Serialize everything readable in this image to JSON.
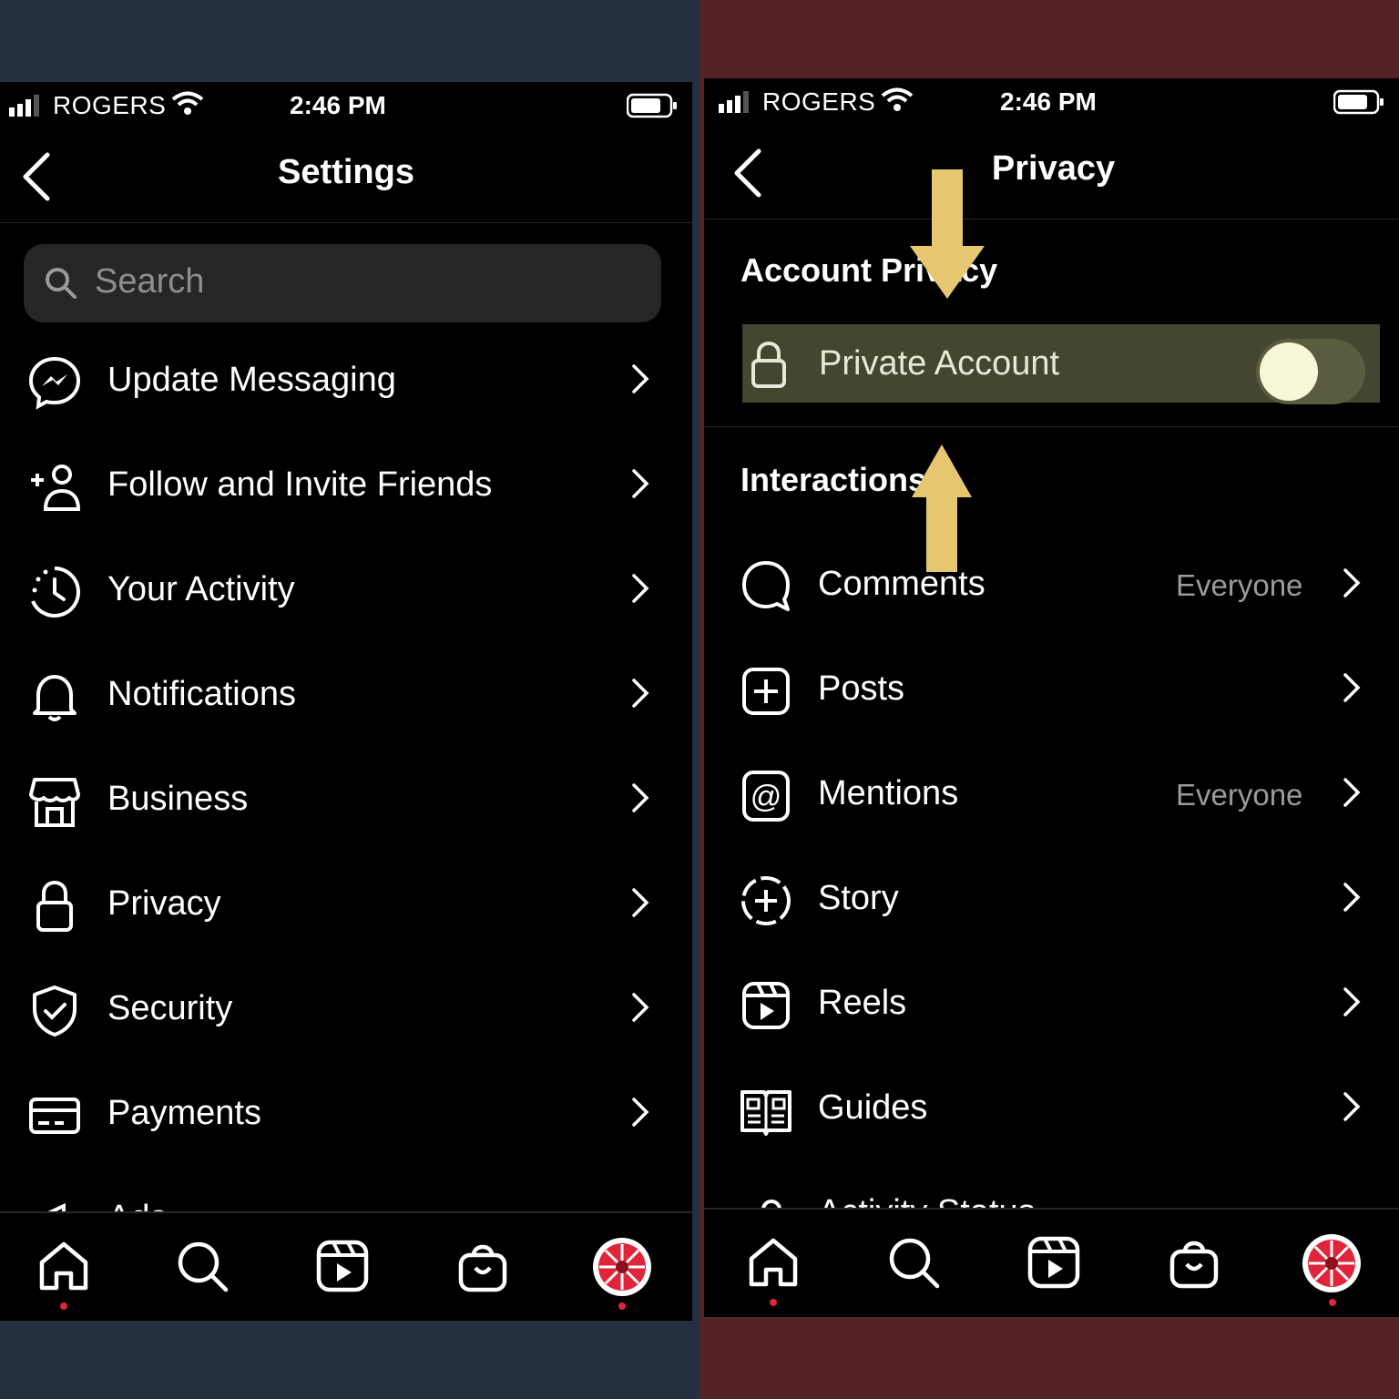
{
  "colors": {
    "left_background": "#243040",
    "right_background": "#552327",
    "highlight": "#44462f",
    "arrow": "#e6c66f",
    "notification_dot": "#e0243a"
  },
  "left": {
    "status": {
      "carrier": "ROGERS",
      "time": "2:46 PM"
    },
    "header": {
      "title": "Settings"
    },
    "search": {
      "placeholder": "Search"
    },
    "items": [
      {
        "label": "Update Messaging",
        "icon": "messenger-icon"
      },
      {
        "label": "Follow and Invite Friends",
        "icon": "add-person-icon"
      },
      {
        "label": "Your Activity",
        "icon": "activity-clock-icon"
      },
      {
        "label": "Notifications",
        "icon": "bell-icon"
      },
      {
        "label": "Business",
        "icon": "storefront-icon"
      },
      {
        "label": "Privacy",
        "icon": "lock-icon"
      },
      {
        "label": "Security",
        "icon": "shield-check-icon"
      },
      {
        "label": "Payments",
        "icon": "credit-card-icon"
      },
      {
        "label": "Ads",
        "icon": "megaphone-icon"
      }
    ]
  },
  "right": {
    "status": {
      "carrier": "ROGERS",
      "time": "2:46 PM"
    },
    "header": {
      "title": "Privacy"
    },
    "account_privacy": {
      "section_title": "Account Privacy",
      "private_account_label": "Private Account",
      "private_account_enabled": false
    },
    "interactions": {
      "section_title": "Interactions",
      "items": [
        {
          "label": "Comments",
          "value": "Everyone",
          "icon": "comment-bubble-icon"
        },
        {
          "label": "Posts",
          "value": "",
          "icon": "plus-square-icon"
        },
        {
          "label": "Mentions",
          "value": "Everyone",
          "icon": "at-sign-icon"
        },
        {
          "label": "Story",
          "value": "",
          "icon": "story-add-icon"
        },
        {
          "label": "Reels",
          "value": "",
          "icon": "reels-icon"
        },
        {
          "label": "Guides",
          "value": "",
          "icon": "guides-icon"
        },
        {
          "label": "Activity Status",
          "value": "",
          "icon": "activity-status-icon"
        }
      ]
    }
  },
  "navbar": {
    "items": [
      "home-icon",
      "search-icon",
      "reels-icon",
      "shop-icon",
      "profile-avatar"
    ]
  }
}
